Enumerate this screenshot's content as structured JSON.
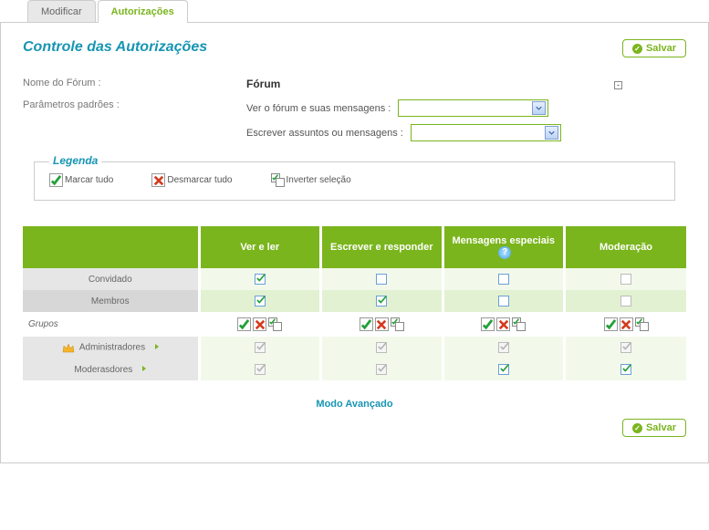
{
  "tabs": {
    "modify": "Modificar",
    "auth": "Autorizações"
  },
  "title": "Controle das Autorizações",
  "save_label": "Salvar",
  "forum_name_label": "Nome do Fórum :",
  "forum_name_value": "Fórum",
  "params_label": "Parâmetros padrões :",
  "param_view": "Ver o fórum e suas mensagens :",
  "param_write": "Escrever assuntos ou mensagens :",
  "legenda": {
    "title": "Legenda",
    "check_all": "Marcar tudo",
    "uncheck_all": "Desmarcar tudo",
    "invert": "Inverter seleção"
  },
  "headers": {
    "view": "Ver e ler",
    "write": "Escrever e responder",
    "special": "Mensagens especiais",
    "mod": "Moderação"
  },
  "rows": {
    "convidado": "Convidado",
    "membros": "Membros",
    "grupos": "Grupos",
    "admins": "Administradores",
    "mods": "Moderasdores"
  },
  "advanced": "Modo Avançado"
}
